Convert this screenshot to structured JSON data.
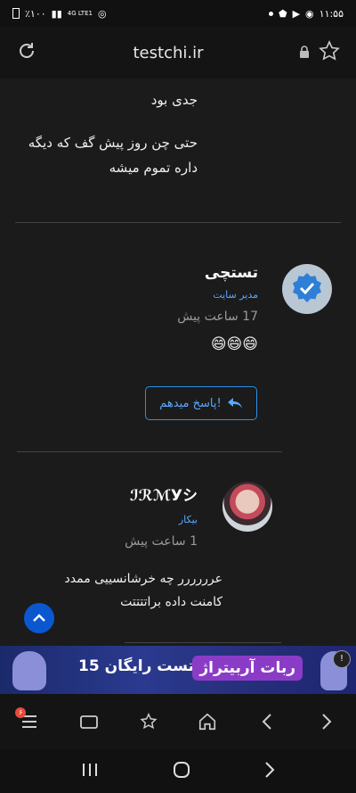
{
  "status_bar": {
    "left_text": "٪۱۰۰",
    "network": "4G LTE1",
    "time": "۱۱:۵۵"
  },
  "browser": {
    "domain": "testchi.ir"
  },
  "top_comment": {
    "line1": "جدی بود",
    "line2": "حتی چن روز پیش گف که دیگه",
    "line3": "داره تموم میشه"
  },
  "comments": [
    {
      "name": "تستچی",
      "role": "مدیر سایت",
      "time": "17 ساعت پیش",
      "text": "😄😄😄",
      "reply_label": "پاسخ میدهم!"
    },
    {
      "name": "ℐℛℳУシ",
      "role": "بیکار",
      "time": "1 ساعت پیش",
      "text_line1": "عرررررر چه خرشانسییی ممدد",
      "text_line2": "کامنت داده براتتتتت"
    }
  ],
  "ad": {
    "title": "ربات آربیتراژ",
    "subtitle": "15 روز تست رایگان",
    "badge": "!"
  },
  "bottom_nav": {
    "menu_badge": "۶"
  }
}
